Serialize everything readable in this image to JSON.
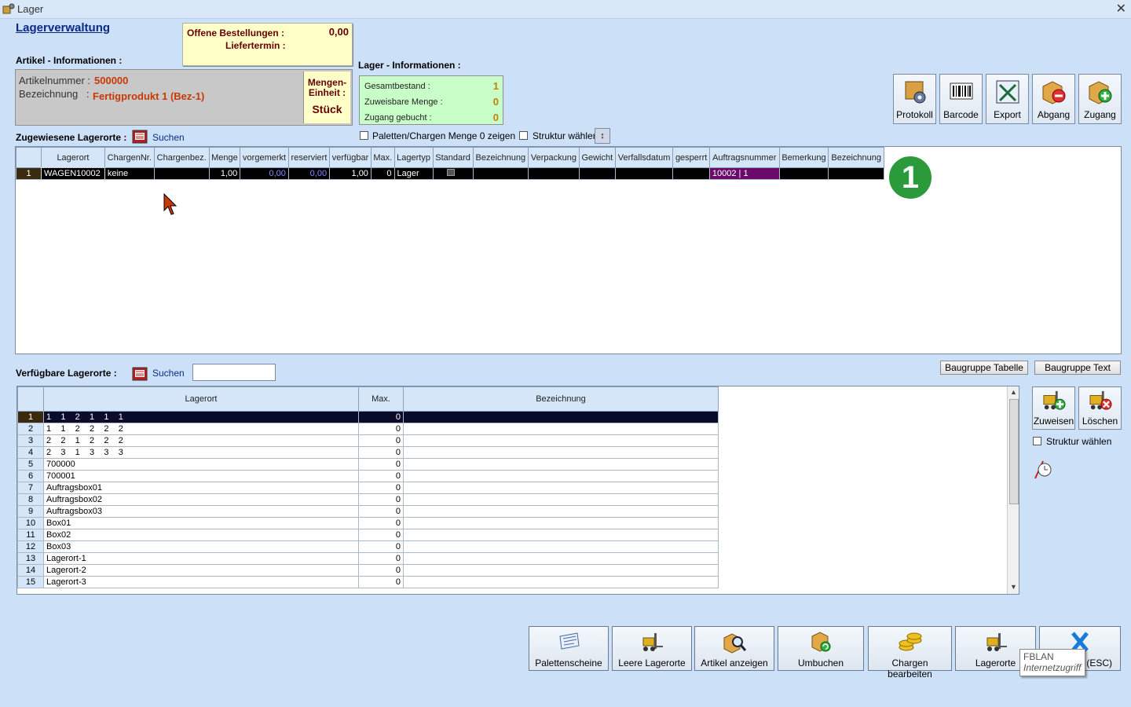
{
  "window": {
    "title": "Lager"
  },
  "header": {
    "page_title": "Lagerverwaltung",
    "article_section": "Artikel - Informationen :",
    "stock_section": "Lager - Informationen :"
  },
  "orders": {
    "open_label": "Offene Bestellungen :",
    "open_value": "0,00",
    "delivery_label": "Liefertermin :"
  },
  "article": {
    "number_label": "Artikelnummer :",
    "number_value": "500000",
    "desc_label": "Bezeichnung",
    "desc_colon": ":",
    "desc_value": "Fertigprodukt 1  (Bez-1)",
    "unit_label_1": "Mengen-",
    "unit_label_2": "Einheit :",
    "unit_value": "Stück"
  },
  "stock": {
    "total_label": "Gesamtbestand :",
    "total_value": "1",
    "assignable_label": "Zuweisbare Menge :",
    "assignable_value": "0",
    "booked_label": "Zugang gebucht :",
    "booked_value": "0"
  },
  "toolbar": {
    "protokoll": "Protokoll",
    "barcode": "Barcode",
    "export": "Export",
    "abgang": "Abgang",
    "zugang": "Zugang"
  },
  "assigned": {
    "label": "Zugewiesene Lagerorte :",
    "search": "Suchen",
    "zero_checkbox": "Paletten/Chargen Menge 0 zeigen",
    "struct_checkbox": "Struktur wählen",
    "columns": [
      "Lagerort",
      "ChargenNr.",
      "Chargenbez.",
      "Menge",
      "vorgemerkt",
      "reserviert",
      "verfügbar",
      "Max.",
      "Lagertyp",
      "Standard",
      "Bezeichnung",
      "Verpackung",
      "Gewicht",
      "Verfallsdatum",
      "gesperrt",
      "Auftragsnummer",
      "Bemerkung",
      "Bezeichnung"
    ],
    "rows": [
      {
        "num": "1",
        "cells": [
          "WAGEN10002",
          "keine",
          "",
          "1,00",
          "0,00",
          "0,00",
          "1,00",
          "0",
          "Lager",
          "",
          "",
          "",
          "",
          "",
          "",
          "10002 | 1",
          "",
          ""
        ]
      }
    ],
    "badge": "1"
  },
  "available": {
    "label": "Verfügbare Lagerorte :",
    "search": "Suchen",
    "search_value": "",
    "btn_table": "Baugruppe Tabelle",
    "btn_text": "Baugruppe Text",
    "columns": [
      "Lagerort",
      "Max.",
      "Bezeichnung"
    ],
    "rows": [
      {
        "num": "1",
        "ort": "1    1    2    1    1    1",
        "max": "0",
        "bez": ""
      },
      {
        "num": "2",
        "ort": "1    1    2    2    2    2",
        "max": "0",
        "bez": ""
      },
      {
        "num": "3",
        "ort": "2    2    1    2    2    2",
        "max": "0",
        "bez": ""
      },
      {
        "num": "4",
        "ort": "2    3    1    3    3    3",
        "max": "0",
        "bez": ""
      },
      {
        "num": "5",
        "ort": "700000",
        "max": "0",
        "bez": ""
      },
      {
        "num": "6",
        "ort": "700001",
        "max": "0",
        "bez": ""
      },
      {
        "num": "7",
        "ort": "Auftragsbox01",
        "max": "0",
        "bez": ""
      },
      {
        "num": "8",
        "ort": "Auftragsbox02",
        "max": "0",
        "bez": ""
      },
      {
        "num": "9",
        "ort": "Auftragsbox03",
        "max": "0",
        "bez": ""
      },
      {
        "num": "10",
        "ort": "Box01",
        "max": "0",
        "bez": ""
      },
      {
        "num": "11",
        "ort": "Box02",
        "max": "0",
        "bez": ""
      },
      {
        "num": "12",
        "ort": "Box03",
        "max": "0",
        "bez": ""
      },
      {
        "num": "13",
        "ort": "Lagerort-1",
        "max": "0",
        "bez": ""
      },
      {
        "num": "14",
        "ort": "Lagerort-2",
        "max": "0",
        "bez": ""
      },
      {
        "num": "15",
        "ort": "Lagerort-3",
        "max": "0",
        "bez": ""
      }
    ],
    "assign": "Zuweisen",
    "delete": "Löschen",
    "struct_checkbox": "Struktur wählen"
  },
  "bottom": {
    "paletten": "Palettenscheine",
    "leere": "Leere Lagerorte",
    "artikel": "Artikel anzeigen",
    "umbuchen": "Umbuchen",
    "chargen": "Chargen bearbeiten",
    "lagerorte": "Lagerorte",
    "esc": "(ESC)"
  },
  "tooltip": {
    "line1": "FBLAN",
    "line2": "Internetzugriff"
  }
}
